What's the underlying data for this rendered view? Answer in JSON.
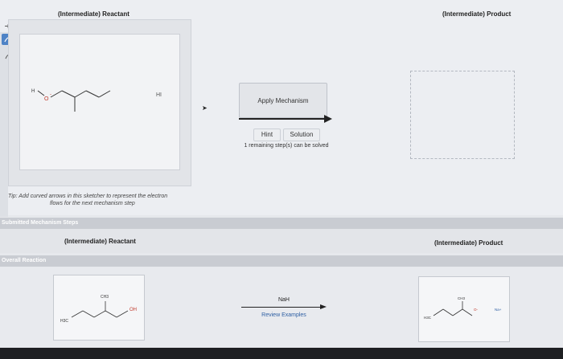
{
  "header": {
    "reactant_title": "(Intermediate) Reactant",
    "product_title": "(Intermediate) Product"
  },
  "toolbar": {
    "tools": [
      "pointer-icon",
      "lasso-icon",
      "undo-icon",
      "redo-icon",
      "delete-icon",
      "copy-icon",
      "paste-icon",
      "zoom-fit-icon",
      "zoom-in-icon",
      "zoom-out-icon",
      "zoom-reset-icon"
    ]
  },
  "sketcher": {
    "oxygen_label": "O",
    "hydrogen_label": "H",
    "charge_label": "-",
    "hi_label": "HI"
  },
  "tip": {
    "line1": "Tip: Add curved arrows in this sketcher to represent the electron",
    "line2": "flows for the next mechanism step"
  },
  "mechanism": {
    "apply_label": "Apply Mechanism",
    "hint_label": "Hint",
    "solution_label": "Solution",
    "remaining_text": "1 remaining step(s) can be solved"
  },
  "submitted": {
    "section_label": "Submitted Mechanism Steps",
    "reactant_title": "(Intermediate) Reactant",
    "product_title": "(Intermediate) Product"
  },
  "overall": {
    "section_label": "Overall Reaction",
    "reagent": "NaH",
    "review_link": "Review Examples",
    "reactant_labels": {
      "ch3": "CH3",
      "oh": "OH",
      "h3c": "H3C"
    },
    "product_labels": {
      "ch3": "CH3",
      "o": "O-",
      "h3c": "H3C",
      "na": "Na+"
    }
  },
  "colors": {
    "accent": "#4e83c6",
    "link": "#2e5fa3",
    "section_bar": "#c9ccd2"
  }
}
